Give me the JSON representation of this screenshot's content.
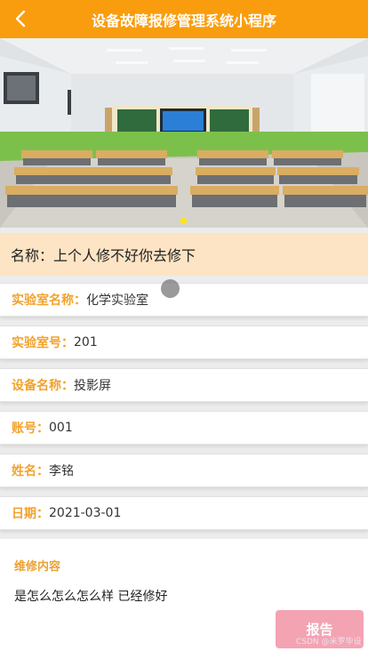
{
  "header": {
    "title": "设备故障报修管理系统小程序"
  },
  "icons": {
    "back": "chevron-left-icon"
  },
  "banner": {
    "alt": "classroom"
  },
  "name_bar": {
    "label": "名称：",
    "value": "上个人修不好你去修下"
  },
  "fields": [
    {
      "label": "实验室名称：",
      "value": "化学实验室"
    },
    {
      "label": "实验室号：",
      "value": "201"
    },
    {
      "label": "设备名称：",
      "value": "投影屏"
    },
    {
      "label": "账号：",
      "value": "001"
    },
    {
      "label": "姓名：",
      "value": "李铭"
    },
    {
      "label": "日期：",
      "value": "2021-03-01"
    }
  ],
  "repair": {
    "title": "维修内容",
    "content": "是怎么怎么怎么样 已经修好"
  },
  "report_button": "报告",
  "watermark": "CSDN @米罗毕设",
  "colors": {
    "header": "#f99d0f",
    "label": "#f2a22c",
    "name_bar": "#fde4c4",
    "button": "#f4a3b3"
  }
}
